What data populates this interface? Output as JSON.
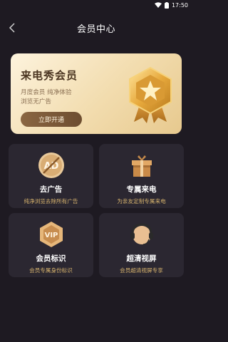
{
  "status": {
    "time": "17:50"
  },
  "nav": {
    "title": "会员中心"
  },
  "banner": {
    "title": "来电秀会员",
    "desc_line1": "月度会员  纯净体验",
    "desc_line2": "浏览无广告",
    "button_label": "立即开通"
  },
  "features": [
    {
      "title": "去广告",
      "subtitle": "纯净浏览去除所有广告",
      "icon": "no-ads-icon"
    },
    {
      "title": "专属来电",
      "subtitle": "为亲友定制专属来电",
      "icon": "gift-box-icon"
    },
    {
      "title": "会员标识",
      "subtitle": "会员专属身份标识",
      "icon": "vip-badge-icon"
    },
    {
      "title": "超清视屏",
      "subtitle": "会员超清视屏专享",
      "icon": "headset-avatar-icon"
    }
  ],
  "colors": {
    "background": "#1e1a22",
    "card": "#2b2731",
    "accent": "#d9b56e"
  }
}
